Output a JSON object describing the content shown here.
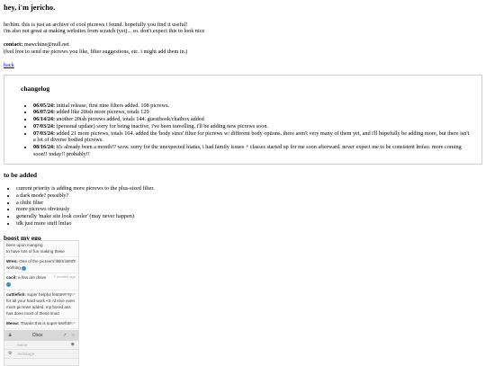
{
  "header": {
    "title": "hey, i'm jericho.",
    "intro_line1": "he/him. this is just an archive of cool picrews i found. hopefully you find it useful!",
    "intro_line2": "i'm also not great at making websites from scratch (yet)... so. don't expect this to look nice",
    "contact_label": "contact:",
    "contact_value": " mawchine@null.net",
    "contact_note": "(feel free to send me picrews you like, filter suggestions, etc. i might add them in.)",
    "back_link": "back"
  },
  "changelog": {
    "title": "changelog",
    "entries": [
      {
        "date": "06/05/24:",
        "text": " initial release, first nine filters added. 108 picrews."
      },
      {
        "date": "06/07/24:",
        "text": " added like 20ish more picrews, totals 129"
      },
      {
        "date": "06/14/24:",
        "text": " another 20ish picrews added, totals 144. guestbook/chatbox added"
      },
      {
        "date": "07/03/24:",
        "text": " (personal update) sorry for being inactive, i've been travelling. i'll be adding new picrews soon."
      },
      {
        "date": "07/03/24:",
        "text": " added 21 more picrews, totals 164. added the 'body sizes' filter for picrews w/ different body options. there aren't very many of them yet, and i'll hopefully be adding more, but there isn't a lot of diverse bodied picrews."
      },
      {
        "date": "08/16/24:",
        "text": " it's already been a month!? wow. sorry for the unexpected hiatus, i had family issues + classes started up for me soon afterward. never expect me to be consistent lmfao. more coming soon!! today!! probably!!"
      }
    ]
  },
  "to_be_added": {
    "title": "to be added",
    "items": [
      "current priority is adding more picrews to the plus-sized filter.",
      "a dark mode? possibly?",
      "a chibi filter",
      "more picrews obviously",
      "generally 'make site look cooler' (may never happen)",
      "idk just more stuff lmfao"
    ]
  },
  "boost": {
    "title": "boost my ego"
  },
  "chatbox": {
    "top_fragment": "been upon manging",
    "top_fragment2": "to have lots of fun making these",
    "messages": [
      {
        "name": "Wren:",
        "time": "5 months ago",
        "text": "One of the picrew's links aren't working"
      },
      {
        "name": "cacil:",
        "time": "7 months ago",
        "text": "a few are down"
      },
      {
        "name": "cuttlefish:",
        "time": "7 months ago",
        "text": "super helpful feature!! ty for all your hard work <3 i'd love even more picrews added. my bored ass has done most of these lmao"
      },
      {
        "name": "Meow:",
        "time": "3 months ago",
        "text": "Thanks this is super useful!!"
      }
    ],
    "brand": "Cbox",
    "name_placeholder": "name",
    "message_placeholder": "message"
  }
}
